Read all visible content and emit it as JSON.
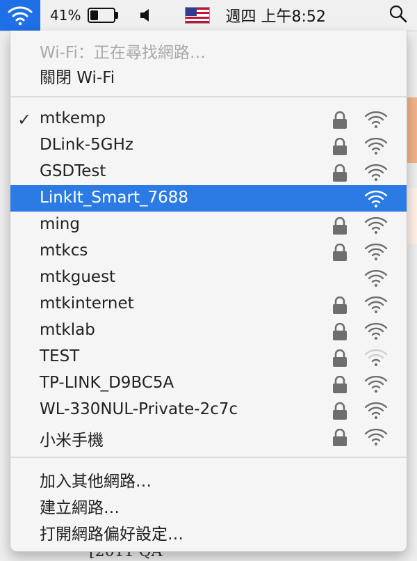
{
  "menubar": {
    "battery_percent": "41%",
    "battery_level": 0.41,
    "clock": "週四 上午8:52",
    "icons": [
      "wifi-icon",
      "battery-icon",
      "speaker-icon",
      "us-flag-icon",
      "search-icon"
    ]
  },
  "wifi_menu": {
    "status": "Wi-Fi：正在尋找網路…",
    "toggle_label": "關閉 Wi-Fi",
    "networks": [
      {
        "name": "mtkemp",
        "connected": true,
        "locked": true,
        "selected": false,
        "signal": "strong"
      },
      {
        "name": "DLink-5GHz",
        "connected": false,
        "locked": true,
        "selected": false,
        "signal": "strong"
      },
      {
        "name": "GSDTest",
        "connected": false,
        "locked": true,
        "selected": false,
        "signal": "strong"
      },
      {
        "name": "LinkIt_Smart_7688",
        "connected": false,
        "locked": false,
        "selected": true,
        "signal": "strong"
      },
      {
        "name": "ming",
        "connected": false,
        "locked": true,
        "selected": false,
        "signal": "strong"
      },
      {
        "name": "mtkcs",
        "connected": false,
        "locked": true,
        "selected": false,
        "signal": "strong"
      },
      {
        "name": "mtkguest",
        "connected": false,
        "locked": false,
        "selected": false,
        "signal": "strong"
      },
      {
        "name": "mtkinternet",
        "connected": false,
        "locked": true,
        "selected": false,
        "signal": "strong"
      },
      {
        "name": "mtklab",
        "connected": false,
        "locked": true,
        "selected": false,
        "signal": "strong"
      },
      {
        "name": "TEST",
        "connected": false,
        "locked": true,
        "selected": false,
        "signal": "weak"
      },
      {
        "name": "TP-LINK_D9BC5A",
        "connected": false,
        "locked": true,
        "selected": false,
        "signal": "strong"
      },
      {
        "name": "WL-330NUL-Private-2c7c",
        "connected": false,
        "locked": true,
        "selected": false,
        "signal": "strong"
      },
      {
        "name": "小米手機",
        "connected": false,
        "locked": true,
        "selected": false,
        "signal": "strong"
      }
    ],
    "actions": {
      "join_other": "加入其他網路…",
      "create_network": "建立網路…",
      "open_prefs": "打開網路偏好設定…"
    },
    "check_mark": "✓"
  },
  "background": {
    "partial_text": "[2011 QA"
  },
  "colors": {
    "selection": "#2c7be5",
    "menubar_active": "#1f6fe7",
    "disabled_text": "#a9a9a9"
  }
}
